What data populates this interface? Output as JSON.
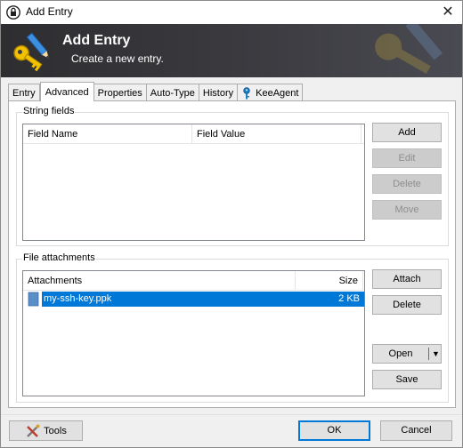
{
  "window": {
    "title": "Add Entry",
    "close_glyph": "✕"
  },
  "banner": {
    "title": "Add Entry",
    "subtitle": "Create a new entry."
  },
  "tabs": [
    {
      "label": "Entry"
    },
    {
      "label": "Advanced",
      "active": true
    },
    {
      "label": "Properties"
    },
    {
      "label": "Auto-Type"
    },
    {
      "label": "History"
    },
    {
      "label": "KeeAgent",
      "icon": "key-icon"
    }
  ],
  "string_fields": {
    "legend": "String fields",
    "columns": [
      "Field Name",
      "Field Value"
    ],
    "rows": [],
    "buttons": {
      "add": "Add",
      "edit": "Edit",
      "delete": "Delete",
      "move": "Move"
    }
  },
  "attachments": {
    "legend": "File attachments",
    "columns": [
      "Attachments",
      "Size"
    ],
    "rows": [
      {
        "name": "my-ssh-key.ppk",
        "size": "2 KB",
        "selected": true
      }
    ],
    "buttons": {
      "attach": "Attach",
      "delete": "Delete",
      "open": "Open",
      "save": "Save"
    }
  },
  "footer": {
    "tools": "Tools",
    "ok": "OK",
    "cancel": "Cancel"
  },
  "colors": {
    "selection": "#0078d7",
    "banner": "#2e2e31",
    "accent_button": "#0078d7"
  }
}
